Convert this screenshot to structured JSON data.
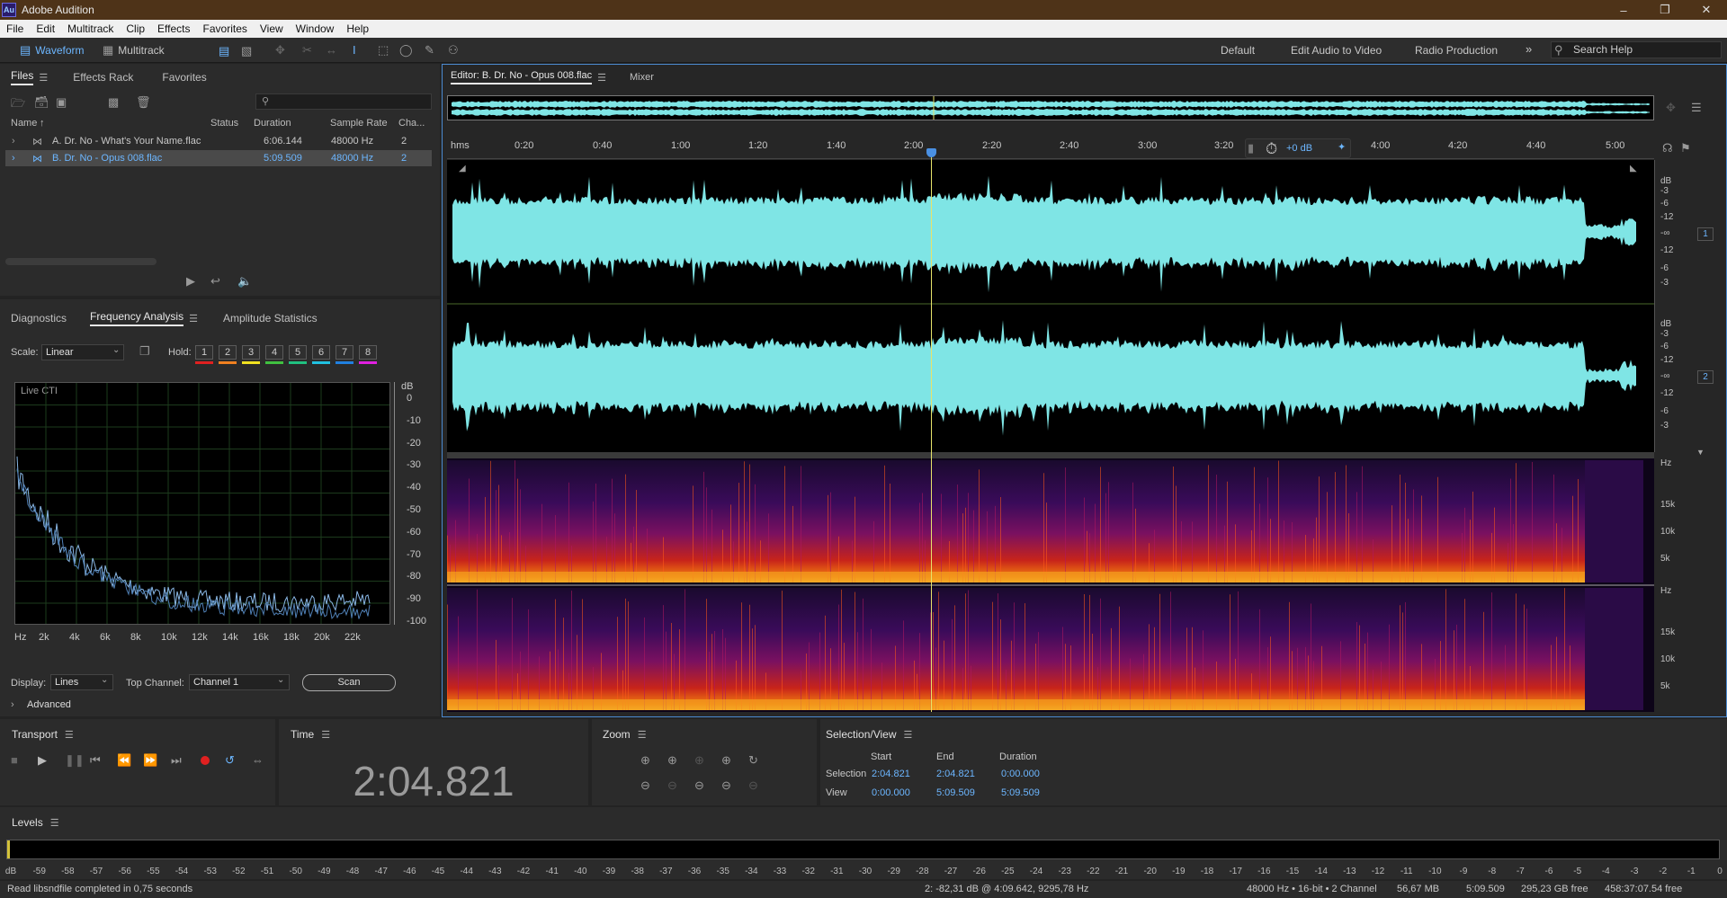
{
  "app": {
    "title": "Adobe Audition",
    "logo": "Au"
  },
  "menu": [
    "File",
    "Edit",
    "Multitrack",
    "Clip",
    "Effects",
    "Favorites",
    "View",
    "Window",
    "Help"
  ],
  "toolbar": {
    "waveform": "Waveform",
    "multitrack": "Multitrack"
  },
  "workspaces": [
    "Default",
    "Edit Audio to Video",
    "Radio Production"
  ],
  "search": {
    "placeholder": "Search Help"
  },
  "files_panel": {
    "tabs": [
      "Files",
      "Effects Rack",
      "Favorites"
    ],
    "columns": [
      "Name",
      "Status",
      "Duration",
      "Sample Rate",
      "Cha..."
    ],
    "rows": [
      {
        "name": "A. Dr. No - What's Your Name.flac",
        "duration": "6:06.144",
        "rate": "48000 Hz",
        "ch": "2"
      },
      {
        "name": "B. Dr. No - Opus 008.flac",
        "duration": "5:09.509",
        "rate": "48000 Hz",
        "ch": "2"
      }
    ]
  },
  "analysis_panel": {
    "tabs": [
      "Diagnostics",
      "Frequency Analysis",
      "Amplitude Statistics"
    ],
    "scale_label": "Scale:",
    "scale_value": "Linear",
    "hold_label": "Hold:",
    "hold_buttons": [
      "1",
      "2",
      "3",
      "4",
      "5",
      "6",
      "7",
      "8"
    ],
    "hold_colors": [
      "#e02020",
      "#f08020",
      "#f0e020",
      "#40c040",
      "#20c080",
      "#20c0e0",
      "#2080e0",
      "#e020e0"
    ],
    "graph_label": "Live CTI",
    "db_unit": "dB",
    "db_ticks": [
      "0",
      "-10",
      "-20",
      "-30",
      "-40",
      "-50",
      "-60",
      "-70",
      "-80",
      "-90",
      "-100"
    ],
    "hz_ticks": [
      "Hz",
      "2k",
      "4k",
      "6k",
      "8k",
      "10k",
      "12k",
      "14k",
      "16k",
      "18k",
      "20k",
      "22k"
    ],
    "display_label": "Display:",
    "display_value": "Lines",
    "top_channel_label": "Top Channel:",
    "top_channel_value": "Channel 1",
    "scan_button": "Scan",
    "advanced": "Advanced"
  },
  "editor": {
    "tab": "Editor: B. Dr. No - Opus 008.flac",
    "mixer": "Mixer",
    "time_ticks": [
      "hms",
      "0:20",
      "0:40",
      "1:00",
      "1:20",
      "1:40",
      "2:00",
      "2:20",
      "2:40",
      "3:00",
      "3:20",
      "4:00",
      "4:20",
      "4:40",
      "5:00"
    ],
    "gain": "+0 dB",
    "db_labels": [
      "dB",
      "-3",
      "-6",
      "-12",
      "-∞",
      "-12",
      "-6",
      "-3"
    ],
    "channel_badges": [
      "1",
      "2"
    ],
    "hz_labels": [
      "Hz",
      "15k",
      "10k",
      "5k"
    ],
    "wave_color": "#7fe5e5",
    "playhead_fraction": 0.4
  },
  "transport": {
    "title": "Transport"
  },
  "time": {
    "title": "Time",
    "value": "2:04.821"
  },
  "zoom": {
    "title": "Zoom"
  },
  "selection_view": {
    "title": "Selection/View",
    "headers": [
      "Start",
      "End",
      "Duration"
    ],
    "selection_label": "Selection",
    "view_label": "View",
    "selection": [
      "2:04.821",
      "2:04.821",
      "0:00.000"
    ],
    "view": [
      "0:00.000",
      "5:09.509",
      "5:09.509"
    ]
  },
  "levels": {
    "title": "Levels",
    "scale": [
      "dB",
      "-59",
      "-58",
      "-57",
      "-56",
      "-55",
      "-54",
      "-53",
      "-52",
      "-51",
      "-50",
      "-49",
      "-48",
      "-47",
      "-46",
      "-45",
      "-44",
      "-43",
      "-42",
      "-41",
      "-40",
      "-39",
      "-38",
      "-37",
      "-36",
      "-35",
      "-34",
      "-33",
      "-32",
      "-31",
      "-30",
      "-29",
      "-28",
      "-27",
      "-26",
      "-25",
      "-24",
      "-23",
      "-22",
      "-21",
      "-20",
      "-19",
      "-18",
      "-17",
      "-16",
      "-15",
      "-14",
      "-13",
      "-12",
      "-11",
      "-10",
      "-9",
      "-8",
      "-7",
      "-6",
      "-5",
      "-4",
      "-3",
      "-2",
      "-1",
      "0"
    ]
  },
  "status": {
    "message": "Read libsndfile completed in 0,75 seconds",
    "cursor": "2: -82,31 dB @ 4:09.642, 9295,78 Hz",
    "format": "48000 Hz • 16-bit • 2 Channel",
    "size": "56,67 MB",
    "duration": "5:09.509",
    "free": "295,23 GB free",
    "time_free": "458:37:07.54 free"
  }
}
